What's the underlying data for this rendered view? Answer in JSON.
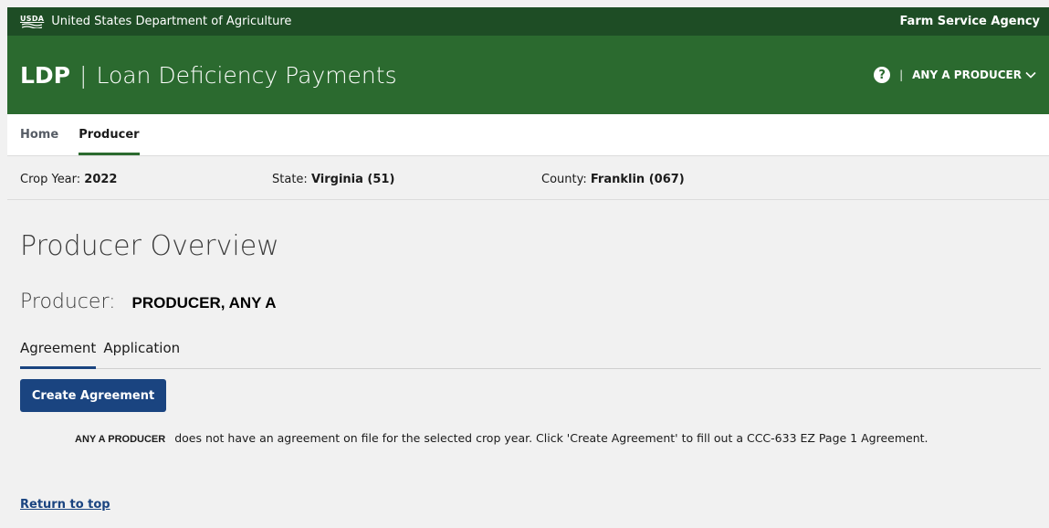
{
  "usda_bar": {
    "logo_text": "USDA",
    "department": "United States Department of Agriculture",
    "agency": "Farm Service Agency"
  },
  "app_header": {
    "abbr": "LDP",
    "separator": "|",
    "full_name": "Loan Deficiency Payments",
    "help_glyph": "?",
    "pipe": "|",
    "user": "ANY A PRODUCER"
  },
  "nav": {
    "items": [
      {
        "label": "Home",
        "active": false
      },
      {
        "label": "Producer",
        "active": true
      }
    ]
  },
  "context": {
    "crop_year_label": "Crop Year:",
    "crop_year_value": "2022",
    "state_label": "State:",
    "state_value": "Virginia (51)",
    "county_label": "County:",
    "county_value": "Franklin (067)"
  },
  "main": {
    "title": "Producer Overview",
    "producer_label": "Producer:",
    "producer_name": "PRODUCER, ANY A",
    "tabs": [
      {
        "label": "Agreement",
        "active": true
      },
      {
        "label": "Application",
        "active": false
      }
    ],
    "create_button": "Create Agreement",
    "notice_who": "ANY A PRODUCER",
    "notice_text": "does not have an agreement on file for the selected crop year. Click 'Create Agreement' to fill out a CCC-633 EZ Page 1 Agreement.",
    "return_link": "Return to top"
  },
  "colors": {
    "usda_bar": "#1e4d25",
    "header": "#2b6a2f",
    "primary_button": "#1a4480",
    "link": "#1a4480"
  }
}
